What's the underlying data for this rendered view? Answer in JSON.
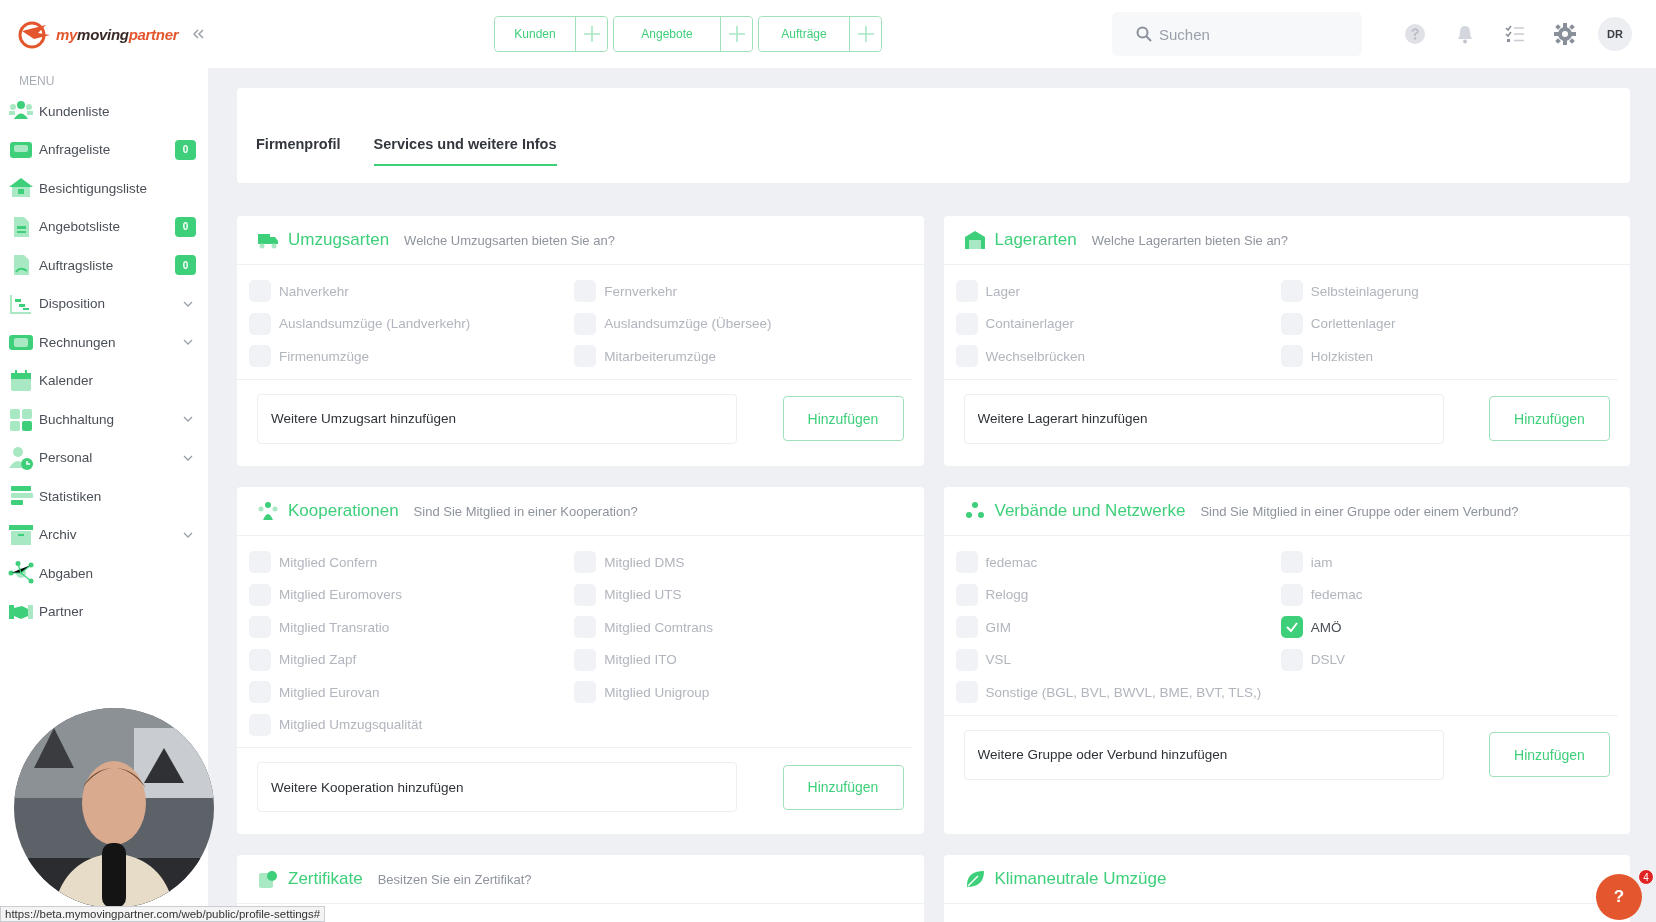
{
  "header": {
    "logo": [
      {
        "text": "my",
        "color": "#e4572e"
      },
      {
        "text": "moving",
        "color": "#3a2a26"
      },
      {
        "text": "partner",
        "color": "#e4572e"
      }
    ],
    "quick_actions": [
      {
        "label": "Kunden"
      },
      {
        "label": "Angebote"
      },
      {
        "label": "Aufträge"
      }
    ],
    "search": {
      "placeholder": "Suchen"
    },
    "avatar": "DR"
  },
  "sidebar": {
    "heading": "MENU",
    "items": [
      {
        "label": "Kundenliste",
        "expandable": false
      },
      {
        "label": "Anfrageliste",
        "badge": "0",
        "expandable": false
      },
      {
        "label": "Besichtigungsliste",
        "expandable": false
      },
      {
        "label": "Angebotsliste",
        "badge": "0",
        "expandable": false
      },
      {
        "label": "Auftragsliste",
        "badge": "0",
        "expandable": false
      },
      {
        "label": "Disposition",
        "expandable": true
      },
      {
        "label": "Rechnungen",
        "expandable": true
      },
      {
        "label": "Kalender",
        "expandable": false
      },
      {
        "label": "Buchhaltung",
        "expandable": true
      },
      {
        "label": "Personal",
        "expandable": true
      },
      {
        "label": "Statistiken",
        "expandable": false
      },
      {
        "label": "Archiv",
        "expandable": true
      },
      {
        "label": "Abgaben",
        "expandable": false
      },
      {
        "label": "Partner",
        "expandable": false
      }
    ]
  },
  "tabs": [
    {
      "label": "Firmenprofil",
      "selected": false
    },
    {
      "label": "Services und weitere Infos",
      "selected": true
    }
  ],
  "sections": [
    {
      "title": "Umzugsarten",
      "question": "Welche Umzugsarten bieten Sie an?",
      "options": [
        {
          "label": "Nahverkehr",
          "checked": false
        },
        {
          "label": "Fernverkehr",
          "checked": false
        },
        {
          "label": "Auslandsumzüge (Landverkehr)",
          "checked": false
        },
        {
          "label": "Auslandsumzüge (Übersee)",
          "checked": false
        },
        {
          "label": "Firmenumzüge",
          "checked": false
        },
        {
          "label": "Mitarbeiterumzüge",
          "checked": false
        }
      ],
      "input": {
        "value": "Weitere Umzugsart hinzufügen"
      },
      "button": "Hinzufügen"
    },
    {
      "title": "Lagerarten",
      "question": "Welche Lagerarten bieten Sie an?",
      "options": [
        {
          "label": "Lager",
          "checked": false
        },
        {
          "label": "Selbsteinlagerung",
          "checked": false
        },
        {
          "label": "Containerlager",
          "checked": false
        },
        {
          "label": "Corlettenlager",
          "checked": false
        },
        {
          "label": "Wechselbrücken",
          "checked": false
        },
        {
          "label": "Holzkisten",
          "checked": false
        }
      ],
      "input": {
        "value": "Weitere Lagerart hinzufügen"
      },
      "button": "Hinzufügen"
    },
    {
      "title": "Kooperationen",
      "question": "Sind Sie Mitglied in einer Kooperation?",
      "options": [
        {
          "label": "Mitglied Confern",
          "checked": false
        },
        {
          "label": "Mitglied DMS",
          "checked": false
        },
        {
          "label": "Mitglied Euromovers",
          "checked": false
        },
        {
          "label": "Mitglied UTS",
          "checked": false
        },
        {
          "label": "Mitglied Transratio",
          "checked": false
        },
        {
          "label": "Mitglied Comtrans",
          "checked": false
        },
        {
          "label": "Mitglied Zapf",
          "checked": false
        },
        {
          "label": "Mitglied ITO",
          "checked": false
        },
        {
          "label": "Mitglied Eurovan",
          "checked": false
        },
        {
          "label": "Mitglied Unigroup",
          "checked": false
        },
        {
          "label": "Mitglied Umzugsqualität",
          "checked": false
        }
      ],
      "input": {
        "value": "Weitere Kooperation hinzufügen"
      },
      "button": "Hinzufügen"
    },
    {
      "title": "Verbände und Netzwerke",
      "question": "Sind Sie Mitglied in einer Gruppe oder einem Verbund?",
      "options": [
        {
          "label": "fedemac",
          "checked": false
        },
        {
          "label": "iam",
          "checked": false
        },
        {
          "label": "Relogg",
          "checked": false
        },
        {
          "label": "fedemac",
          "checked": false
        },
        {
          "label": "GIM",
          "checked": false
        },
        {
          "label": "AMÖ",
          "checked": true
        },
        {
          "label": "VSL",
          "checked": false
        },
        {
          "label": "DSLV",
          "checked": false
        },
        {
          "label": "Sonstige (BGL, BVL, BWVL, BME, BVT, TLS,)",
          "checked": false
        }
      ],
      "input": {
        "value": "Weitere Gruppe oder Verbund hinzufügen"
      },
      "button": "Hinzufügen"
    },
    {
      "title": "Zertifikate",
      "question": "Besitzen Sie ein Zertifikat?"
    },
    {
      "title": "Klimaneutrale Umzüge"
    }
  ],
  "status_url": "https://beta.mymovingpartner.com/web/public/profile-settings#",
  "help": {
    "label": "?",
    "badge": "4"
  }
}
